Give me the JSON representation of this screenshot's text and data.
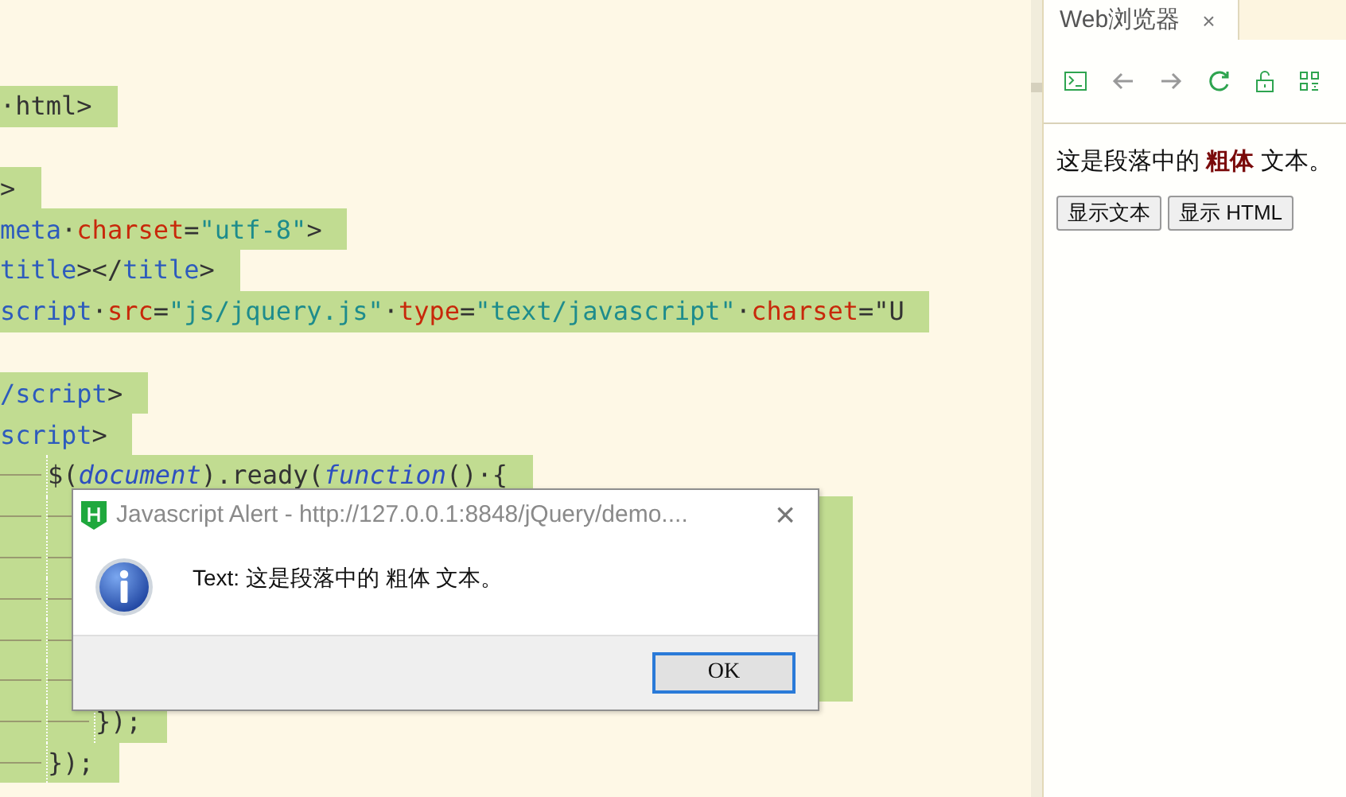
{
  "editor": {
    "lines": [
      {
        "selected": false
      },
      {
        "selected": true,
        "tokens": [
          {
            "kind": "plain",
            "text": "·html>"
          }
        ]
      },
      {
        "selected": false
      },
      {
        "selected": true,
        "tokens": [
          {
            "kind": "plain",
            "text": ">"
          }
        ]
      },
      {
        "selected": true,
        "tokens": [
          {
            "kind": "tag",
            "text": "meta"
          },
          {
            "kind": "plain",
            "text": "·"
          },
          {
            "kind": "attr",
            "text": "charset"
          },
          {
            "kind": "plain",
            "text": "="
          },
          {
            "kind": "str",
            "text": "\"utf-8\""
          },
          {
            "kind": "plain",
            "text": ">"
          }
        ]
      },
      {
        "selected": true,
        "tokens": [
          {
            "kind": "tag",
            "text": "title"
          },
          {
            "kind": "plain",
            "text": "></"
          },
          {
            "kind": "tag",
            "text": "title"
          },
          {
            "kind": "plain",
            "text": ">"
          }
        ]
      },
      {
        "selected": true,
        "tokens": [
          {
            "kind": "tag",
            "text": "script"
          },
          {
            "kind": "plain",
            "text": "·"
          },
          {
            "kind": "attr",
            "text": "src"
          },
          {
            "kind": "plain",
            "text": "="
          },
          {
            "kind": "str",
            "text": "\"js/jquery.js\""
          },
          {
            "kind": "plain",
            "text": "·"
          },
          {
            "kind": "attr",
            "text": "type"
          },
          {
            "kind": "plain",
            "text": "="
          },
          {
            "kind": "str",
            "text": "\"text/javascript\""
          },
          {
            "kind": "plain",
            "text": "·"
          },
          {
            "kind": "attr",
            "text": "charset"
          },
          {
            "kind": "plain",
            "text": "=\"U"
          }
        ]
      },
      {
        "selected": false
      },
      {
        "selected": true,
        "tokens": [
          {
            "kind": "tag",
            "text": "/script"
          },
          {
            "kind": "plain",
            "text": ">"
          }
        ]
      },
      {
        "selected": true,
        "tokens": [
          {
            "kind": "tag",
            "text": "script"
          },
          {
            "kind": "plain",
            "text": ">"
          }
        ]
      },
      {
        "selected": true,
        "tokens": [
          {
            "kind": "indent"
          },
          {
            "kind": "plain",
            "text": "$("
          },
          {
            "kind": "italic",
            "text": "document"
          },
          {
            "kind": "plain",
            "text": ").ready("
          },
          {
            "kind": "italic",
            "text": "function"
          },
          {
            "kind": "plain",
            "text": "()·{"
          }
        ]
      },
      {
        "selected": true,
        "tokens": [
          {
            "kind": "indent"
          },
          {
            "kind": "indent"
          }
        ]
      },
      {
        "selected": true,
        "tokens": [
          {
            "kind": "indent"
          },
          {
            "kind": "indent"
          }
        ]
      },
      {
        "selected": true,
        "tokens": [
          {
            "kind": "indent"
          },
          {
            "kind": "indent"
          }
        ]
      },
      {
        "selected": true,
        "tokens": [
          {
            "kind": "indent"
          },
          {
            "kind": "indent"
          }
        ]
      },
      {
        "selected": true,
        "tokens": [
          {
            "kind": "indent"
          },
          {
            "kind": "indent"
          }
        ]
      },
      {
        "selected": true,
        "tokens": [
          {
            "kind": "indent"
          },
          {
            "kind": "indent"
          },
          {
            "kind": "plain",
            "text": "});"
          }
        ]
      },
      {
        "selected": true,
        "tokens": [
          {
            "kind": "indent"
          },
          {
            "kind": "plain",
            "text": "});"
          }
        ]
      }
    ]
  },
  "browser": {
    "tabs": [
      {
        "label": "Web浏览器",
        "close": "×",
        "selected": true
      }
    ],
    "paragraph": "这是段落中的 **粗体** 文本。",
    "buttons": [
      "显示文本",
      "显示 HTML"
    ]
  },
  "alert": {
    "title": "Javascript Alert - http://127.0.0.1:8848/jQuery/demo....",
    "close": "×",
    "message": "Text: 这是段落中的 粗体 文本。",
    "button": "OK"
  }
}
